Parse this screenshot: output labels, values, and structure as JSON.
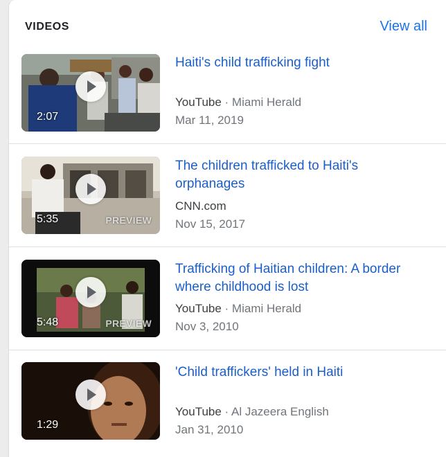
{
  "header": {
    "title": "VIDEOS",
    "view_all": "View all"
  },
  "videos": [
    {
      "title_line1": "Haiti's child trafficking fight",
      "title_line2": "",
      "source": "YouTube",
      "separator": " · ",
      "channel": "Miami Herald",
      "date": "Mar 11, 2019",
      "duration": "2:07",
      "preview": ""
    },
    {
      "title_line1": "The children trafficked to Haiti's",
      "title_line2": "orphanages",
      "source": "CNN.com",
      "separator": "",
      "channel": "",
      "date": "Nov 15, 2017",
      "duration": "5:35",
      "preview": "PREVIEW"
    },
    {
      "title_line1": "Trafficking of Haitian children: A border",
      "title_line2": "where childhood is lost",
      "source": "YouTube",
      "separator": " · ",
      "channel": "Miami Herald",
      "date": "Nov 3, 2010",
      "duration": "5:48",
      "preview": "PREVIEW"
    },
    {
      "title_line1": "'Child traffickers' held in Haiti",
      "title_line2": "",
      "source": "YouTube",
      "separator": " · ",
      "channel": "Al Jazeera English",
      "date": "Jan 31, 2010",
      "duration": "1:29",
      "preview": ""
    }
  ],
  "colors": {
    "link": "#1a5fc9",
    "accent": "#1a73e8",
    "meta": "#70757a"
  },
  "icons": {
    "play": "play-icon"
  }
}
